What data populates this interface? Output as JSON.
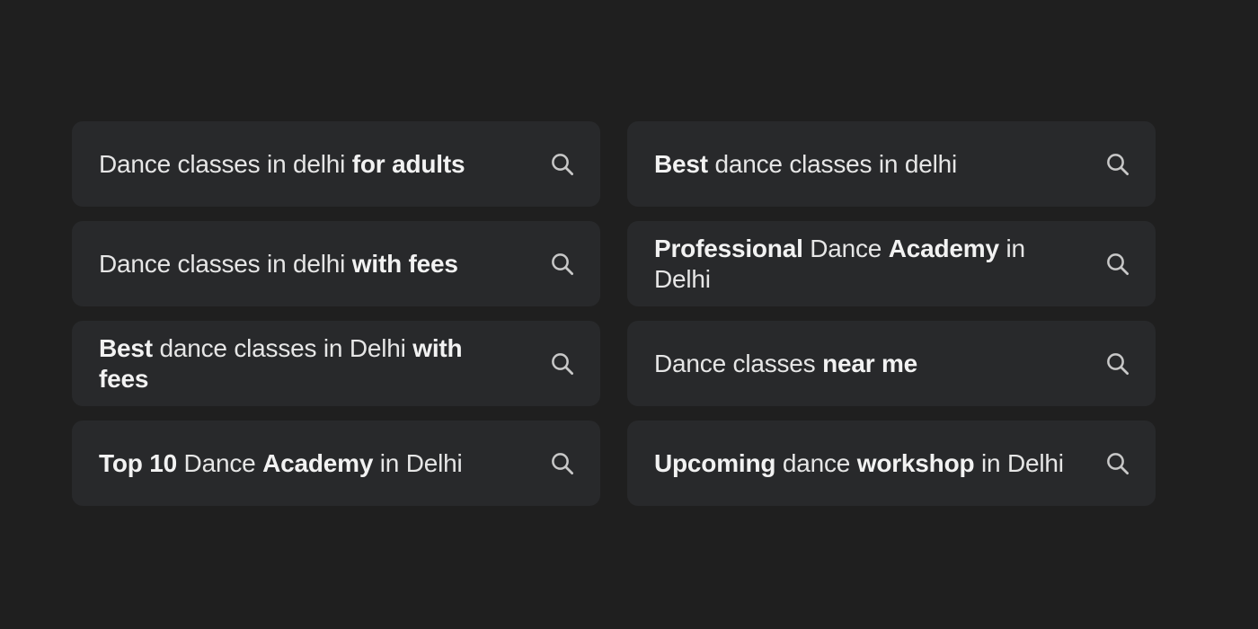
{
  "suggestions": [
    {
      "segments": [
        {
          "text": "Dance classes in delhi ",
          "bold": false
        },
        {
          "text": "for adults",
          "bold": true
        }
      ]
    },
    {
      "segments": [
        {
          "text": "Best",
          "bold": true
        },
        {
          "text": " dance classes in delhi",
          "bold": false
        }
      ]
    },
    {
      "segments": [
        {
          "text": "Dance classes in delhi ",
          "bold": false
        },
        {
          "text": "with fees",
          "bold": true
        }
      ]
    },
    {
      "segments": [
        {
          "text": "Professional",
          "bold": true
        },
        {
          "text": " Dance ",
          "bold": false
        },
        {
          "text": "Academy",
          "bold": true
        },
        {
          "text": " in Delhi",
          "bold": false
        }
      ]
    },
    {
      "segments": [
        {
          "text": "Best",
          "bold": true
        },
        {
          "text": " dance classes in Delhi ",
          "bold": false
        },
        {
          "text": "with fees",
          "bold": true
        }
      ]
    },
    {
      "segments": [
        {
          "text": "Dance classes ",
          "bold": false
        },
        {
          "text": "near me",
          "bold": true
        }
      ]
    },
    {
      "segments": [
        {
          "text": "Top 10",
          "bold": true
        },
        {
          "text": " Dance ",
          "bold": false
        },
        {
          "text": "Academy",
          "bold": true
        },
        {
          "text": " in Delhi",
          "bold": false
        }
      ]
    },
    {
      "segments": [
        {
          "text": "Upcoming",
          "bold": true
        },
        {
          "text": " dance ",
          "bold": false
        },
        {
          "text": "workshop",
          "bold": true
        },
        {
          "text": " in Delhi",
          "bold": false
        }
      ]
    }
  ],
  "icon": "search-icon",
  "colors": {
    "background": "#1f1f1f",
    "card": "#28292b",
    "text": "#e6e6e6",
    "icon": "#c8c8c8"
  }
}
